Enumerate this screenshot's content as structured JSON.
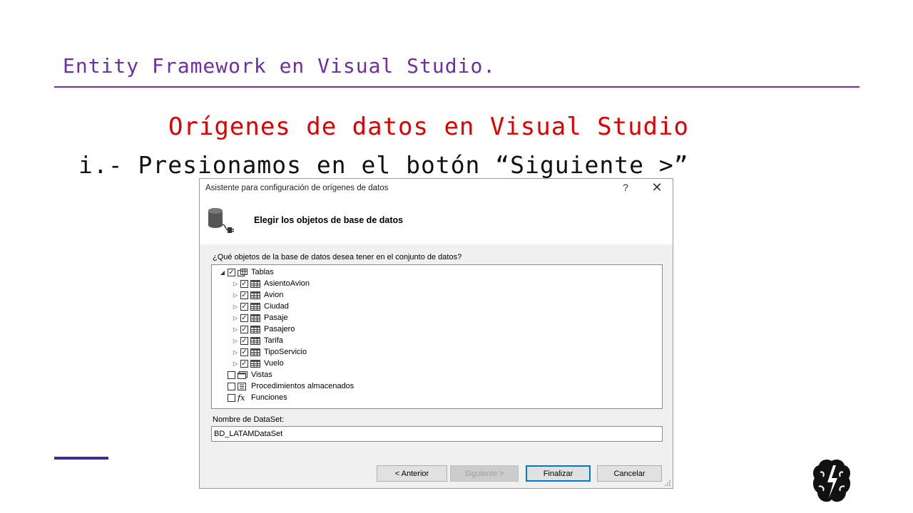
{
  "slide": {
    "title": "Entity Framework en Visual Studio.",
    "heading": "Orígenes de datos en Visual Studio",
    "step": "i.- Presionamos en el botón “Siguiente >”"
  },
  "dialog": {
    "title": "Asistente para configuración de orígenes de datos",
    "help": "?",
    "close": "✕",
    "header_title": "Elegir los objetos de base de datos",
    "tree_label": "¿Qué objetos de la base de datos desea tener en el conjunto de datos?",
    "tree": {
      "root": {
        "label": "Tablas",
        "checked": true,
        "expanded": true
      },
      "tables": [
        {
          "label": "AsientoAvion",
          "checked": true
        },
        {
          "label": "Avion",
          "checked": true
        },
        {
          "label": "Ciudad",
          "checked": true
        },
        {
          "label": "Pasaje",
          "checked": true
        },
        {
          "label": "Pasajero",
          "checked": true
        },
        {
          "label": "Tarifa",
          "checked": true
        },
        {
          "label": "TipoServicio",
          "checked": true
        },
        {
          "label": "Vuelo",
          "checked": true
        }
      ],
      "others": [
        {
          "label": "Vistas",
          "checked": false,
          "icon": "view-icon"
        },
        {
          "label": "Procedimientos almacenados",
          "checked": false,
          "icon": "stored-procedure-icon"
        },
        {
          "label": "Funciones",
          "checked": false,
          "icon": "function-icon",
          "glyph": "fx"
        }
      ]
    },
    "dataset_label": "Nombre de DataSet:",
    "dataset_value": "BD_LATAMDataSet",
    "buttons": {
      "back": "< Anterior",
      "next": "Siguiente >",
      "finish": "Finalizar",
      "cancel": "Cancelar"
    }
  },
  "colors": {
    "title": "#6f2da8",
    "heading": "#e00000",
    "accent_bar": "#3a2fa0",
    "focus_border": "#0078d7"
  }
}
